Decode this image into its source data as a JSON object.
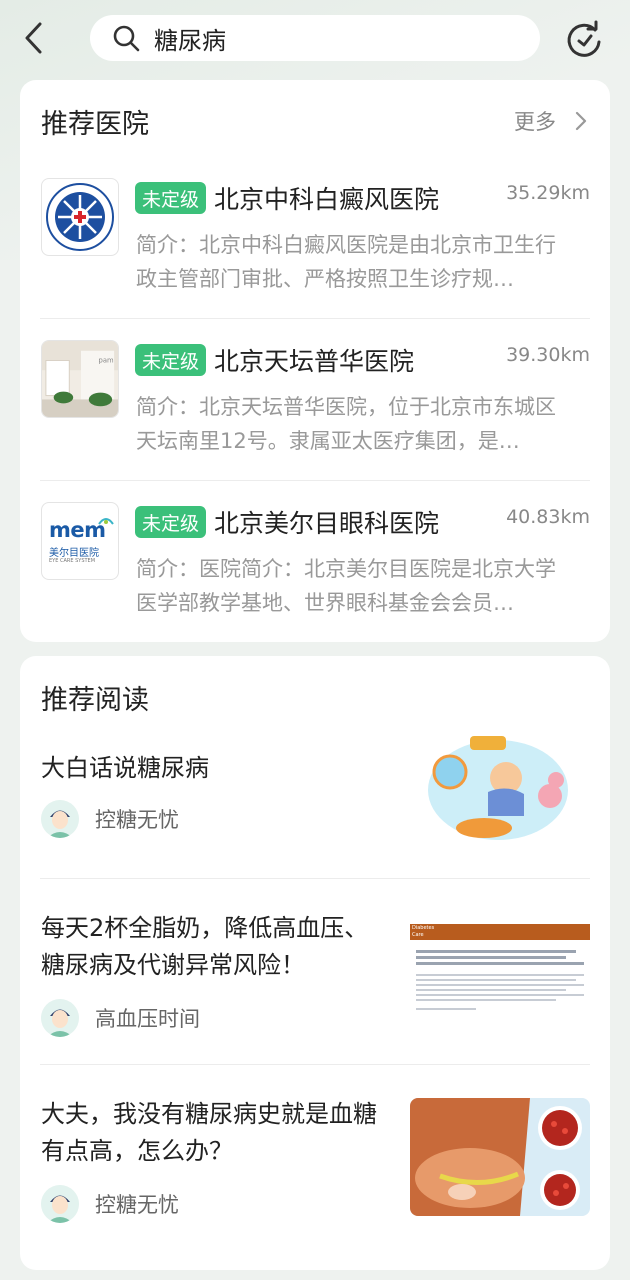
{
  "search": {
    "query": "糖尿病"
  },
  "hospitals_section": {
    "title": "推荐医院",
    "more_label": "更多",
    "items": [
      {
        "badge": "未定级",
        "name": "北京中科白癜风医院",
        "distance": "35.29km",
        "desc": "简介：北京中科白癜风医院是由北京市卫生行政主管部门审批、严格按照卫生诊疗规…"
      },
      {
        "badge": "未定级",
        "name": "北京天坛普华医院",
        "distance": "39.30km",
        "desc": "简介：北京天坛普华医院，位于北京市东城区天坛南里12号。隶属亚太医疗集团，是…"
      },
      {
        "badge": "未定级",
        "name": "北京美尔目眼科医院",
        "distance": "40.83km",
        "desc": "简介：医院简介：北京美尔目医院是北京大学医学部教学基地、世界眼科基金会会员…",
        "logo_text": "mem",
        "logo_sub": "美尔目医院",
        "logo_sub2": "EYE CARE SYSTEM"
      }
    ]
  },
  "reading_section": {
    "title": "推荐阅读",
    "items": [
      {
        "title": "大白话说糖尿病",
        "author": "控糖无忧"
      },
      {
        "title": "每天2杯全脂奶，降低高血压、糖尿病及代谢异常风险！",
        "author": "高血压时间",
        "thumb_header": "Diabetes Care"
      },
      {
        "title": "大夫，我没有糖尿病史就是血糖有点高，怎么办？",
        "author": "控糖无忧"
      }
    ]
  },
  "colors": {
    "badge_green": "#3bc07a",
    "background": "#eef2ef"
  }
}
